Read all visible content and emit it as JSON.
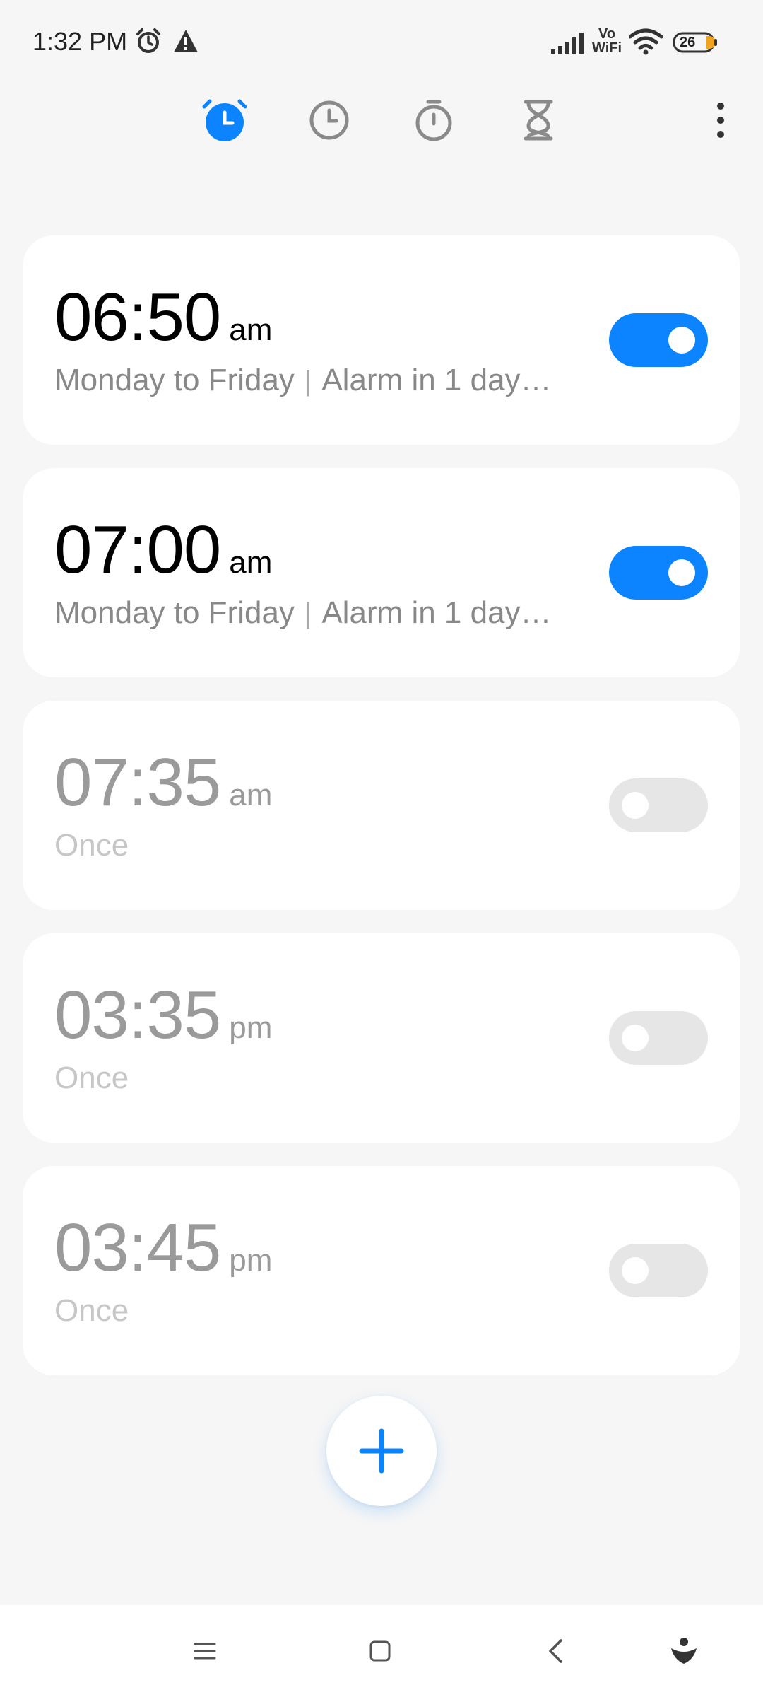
{
  "status_bar": {
    "time": "1:32 PM",
    "network_label_top": "Vo",
    "network_label_bottom": "WiFi",
    "battery": "26",
    "icons": [
      "alarm-icon",
      "warning-icon",
      "signal-icon",
      "vowifi-icon",
      "wifi-icon",
      "battery-icon"
    ]
  },
  "toolbar": {
    "tabs": [
      {
        "name": "alarm",
        "icon": "alarm-clock-icon",
        "active": true
      },
      {
        "name": "world-clock",
        "icon": "clock-icon",
        "active": false
      },
      {
        "name": "stopwatch",
        "icon": "stopwatch-icon",
        "active": false
      },
      {
        "name": "timer",
        "icon": "hourglass-icon",
        "active": false
      }
    ],
    "menu_icon": "more-vertical-icon"
  },
  "alarms": [
    {
      "time": "06:50",
      "ampm": "am",
      "repeat": "Monday to Friday",
      "next": "Alarm in 1 day…",
      "enabled": true
    },
    {
      "time": "07:00",
      "ampm": "am",
      "repeat": "Monday to Friday",
      "next": "Alarm in 1 day…",
      "enabled": true
    },
    {
      "time": "07:35",
      "ampm": "am",
      "repeat": "Once",
      "enabled": false
    },
    {
      "time": "03:35",
      "ampm": "pm",
      "repeat": "Once",
      "enabled": false
    },
    {
      "time": "03:45",
      "ampm": "pm",
      "repeat": "Once",
      "enabled": false
    }
  ],
  "fab": {
    "icon": "plus-icon"
  },
  "nav_bar": {
    "icons": [
      "menu-icon",
      "home-icon",
      "back-icon",
      "assistant-icon"
    ]
  },
  "colors": {
    "accent": "#0d84ff",
    "background": "#f6f6f6",
    "card": "#ffffff",
    "toggle_off": "#e6e6e6"
  }
}
